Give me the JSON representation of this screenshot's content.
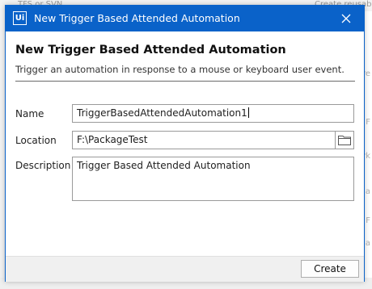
{
  "background": {
    "top_left_text": "TFS or SVN",
    "top_right_text": "Create reusab",
    "fragments": [
      "re",
      "F",
      "rk",
      "a",
      "F",
      "a"
    ]
  },
  "dialog": {
    "app_icon_text": "Ui",
    "window_title": "New Trigger Based Attended Automation",
    "close_icon": "close-icon",
    "heading": "New Trigger Based Attended Automation",
    "subheading": "Trigger an automation in response to a mouse or keyboard user event.",
    "fields": {
      "name_label": "Name",
      "name_value": "TriggerBasedAttendedAutomation1",
      "location_label": "Location",
      "location_value": "F:\\PackageTest",
      "description_label": "Description",
      "description_value": "Trigger Based Attended Automation",
      "folder_icon": "folder-icon"
    },
    "create_label": "Create"
  },
  "colors": {
    "accent": "#0a62c9",
    "footer": "#f0f0f0"
  }
}
